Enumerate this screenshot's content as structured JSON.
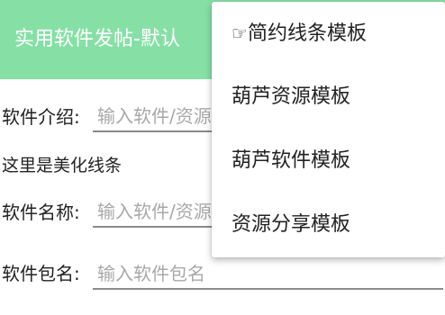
{
  "app_bar": {
    "title": "实用软件发帖-默认",
    "color": "#86e0a6"
  },
  "form": {
    "intro_label": "软件介绍:",
    "intro_placeholder": "输入软件/资源",
    "decor_text": "这里是美化线条",
    "name_label": "软件名称:",
    "name_placeholder": "输入软件/资源",
    "package_label": "软件包名:",
    "package_placeholder": "输入软件包名"
  },
  "menu": {
    "items": [
      {
        "icon": "pointing-hand-icon",
        "icon_glyph": "☞",
        "label": "简约线条模板"
      },
      {
        "label": "葫芦资源模板"
      },
      {
        "label": "葫芦软件模板"
      },
      {
        "label": "资源分享模板"
      }
    ]
  }
}
